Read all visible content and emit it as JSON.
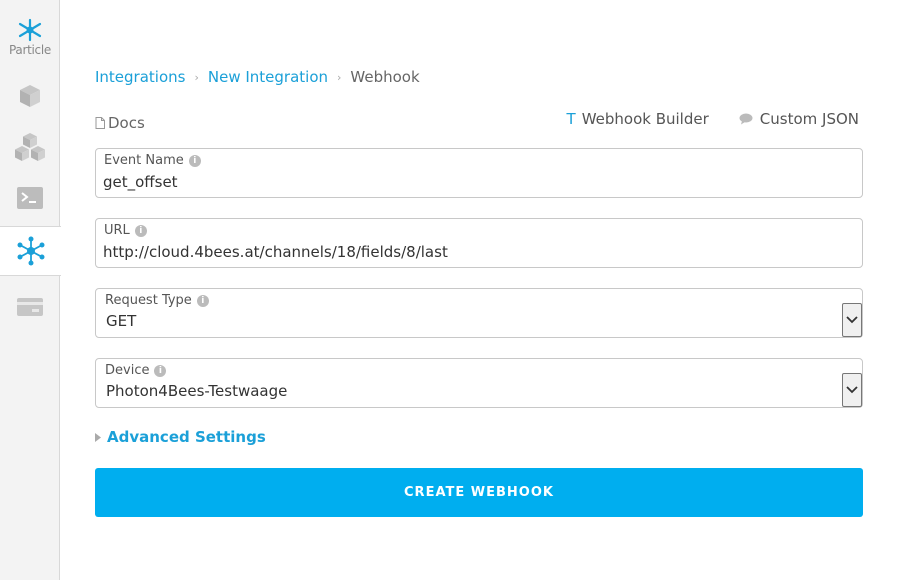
{
  "sidebar": {
    "logo_text": "Particle",
    "items": [
      {
        "icon": "cube-icon"
      },
      {
        "icon": "cubes-icon"
      },
      {
        "icon": "terminal-icon"
      },
      {
        "icon": "integrations-icon",
        "active": true
      },
      {
        "icon": "billing-card-icon"
      }
    ]
  },
  "breadcrumb": {
    "items": [
      "Integrations",
      "New Integration",
      "Webhook"
    ],
    "separator": "›"
  },
  "docs_label": "Docs",
  "tabs": {
    "builder_icon": "T",
    "builder_label": "Webhook Builder",
    "json_label": "Custom JSON"
  },
  "form": {
    "event_name": {
      "label": "Event Name",
      "value": "get_offset"
    },
    "url": {
      "label": "URL",
      "value": "http://cloud.4bees.at/channels/18/fields/8/last"
    },
    "request_type": {
      "label": "Request Type",
      "value": "GET"
    },
    "device": {
      "label": "Device",
      "value": "Photon4Bees-Testwaage"
    },
    "info_glyph": "i"
  },
  "advanced_label": "Advanced Settings",
  "create_label": "CREATE WEBHOOK",
  "colors": {
    "accent": "#00aeef",
    "link": "#1ba0d8",
    "sidebar_bg": "#f3f3f3"
  }
}
